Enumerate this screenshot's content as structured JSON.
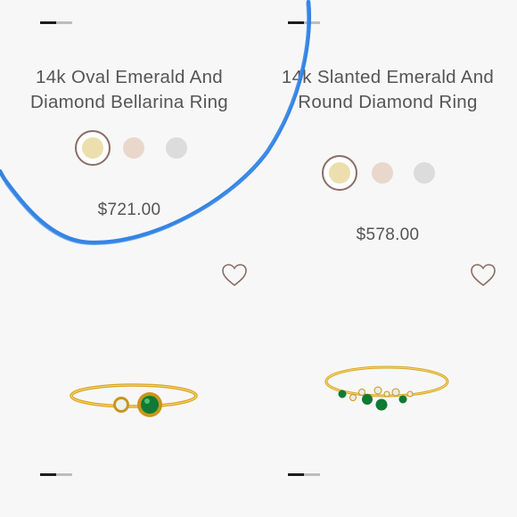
{
  "products": [
    {
      "title": "14k Oval Emerald And Diamond Bellarina Ring",
      "price": "$721.00",
      "swatches": [
        {
          "name": "yellow-gold",
          "color": "#eddeae",
          "selected": true
        },
        {
          "name": "rose-gold",
          "color": "#ead7cc",
          "selected": false
        },
        {
          "name": "white-gold",
          "color": "#dcdcdc",
          "selected": false
        }
      ]
    },
    {
      "title": "14k Slanted Emerald And Round Diamond Ring",
      "price": "$578.00",
      "swatches": [
        {
          "name": "yellow-gold",
          "color": "#eddeae",
          "selected": true
        },
        {
          "name": "rose-gold",
          "color": "#ead7cc",
          "selected": false
        },
        {
          "name": "white-gold",
          "color": "#dcdcdc",
          "selected": false
        }
      ]
    }
  ],
  "colors": {
    "accent": "#8a6d64",
    "heart": "#8a6d64",
    "scribble": "#2a7de1",
    "gold": "#d9a420",
    "emerald": "#0f7a35"
  },
  "icons": {
    "heart": "heart-outline-icon",
    "slider": "slider-indicator-icon"
  }
}
